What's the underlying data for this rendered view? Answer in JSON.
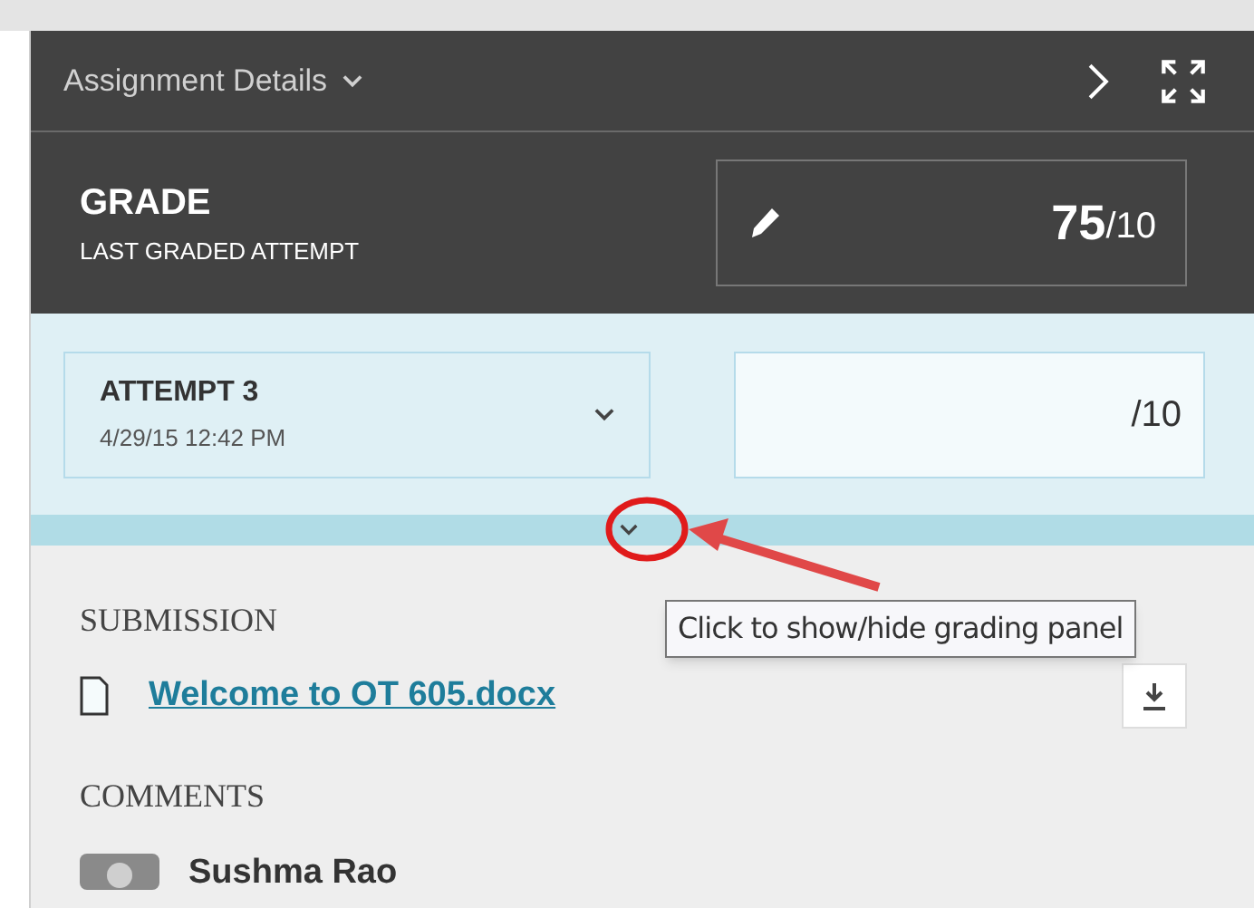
{
  "header": {
    "title": "Assignment Details"
  },
  "grade": {
    "title": "GRADE",
    "subtitle": "LAST GRADED ATTEMPT",
    "score": "75",
    "out_of": "/10"
  },
  "attempt": {
    "title": "ATTEMPT 3",
    "date": "4/29/15 12:42 PM",
    "grade_out_of": "/10"
  },
  "tooltip": "Click to show/hide grading panel",
  "submission": {
    "heading": "SUBMISSION",
    "file": "Welcome to OT 605.docx"
  },
  "comments": {
    "heading": "COMMENTS",
    "author": "Sushma Rao"
  }
}
